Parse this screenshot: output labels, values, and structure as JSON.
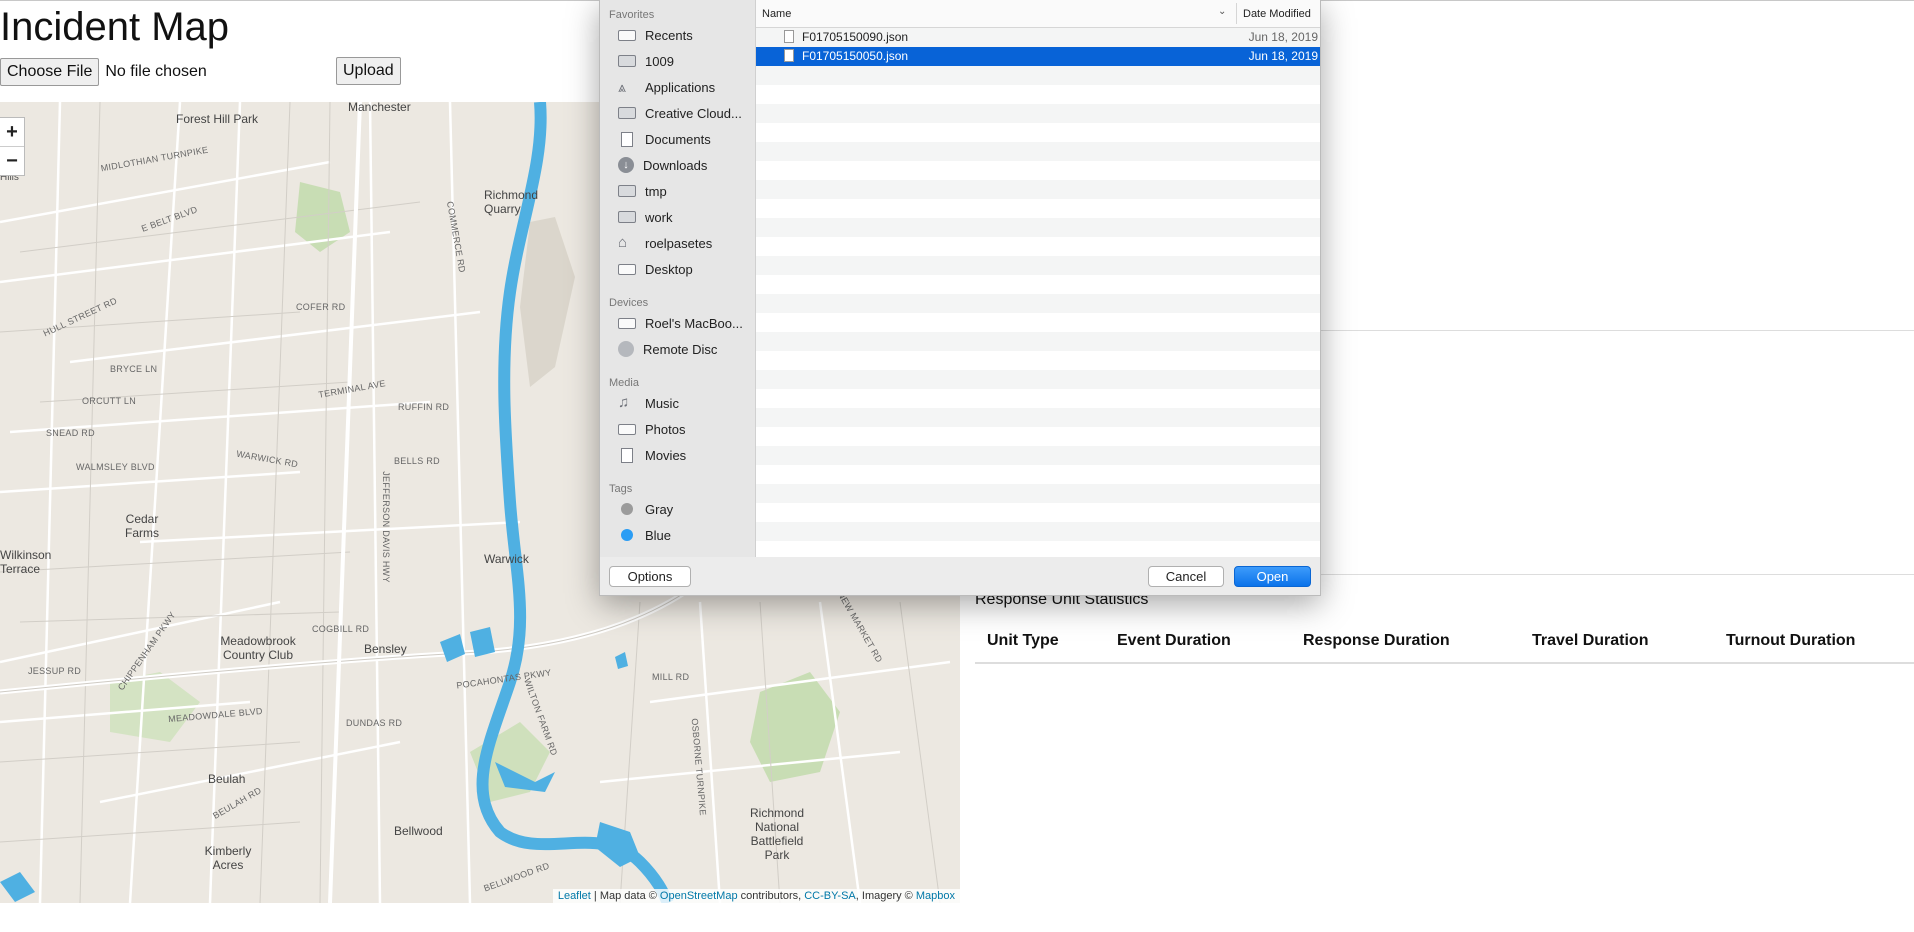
{
  "page": {
    "title": "Incident Map",
    "choose_file_label": "Choose File",
    "file_status": "No file chosen",
    "upload_label": "Upload"
  },
  "map": {
    "zoom_in": "+",
    "zoom_out": "−",
    "places": [
      "Forest Hill Park",
      "Manchester",
      "Richmond Quarry",
      "Cedar Farms",
      "Meadowbrook Country Club",
      "Bensley",
      "Warwick",
      "Beulah",
      "Kimberly Acres",
      "Bellwood",
      "Richmond National Battlefield Park",
      "Wilkinson Terrace",
      "Hills"
    ],
    "roads": [
      "MIDLOTHIAN TURNPIKE",
      "E BELT BLVD",
      "COFER RD",
      "HULL STREET RD",
      "BRYCE LN",
      "ORCUTT LN",
      "SNEAD RD",
      "WALMSLEY BLVD",
      "WARWICK RD",
      "TERMINAL AVE",
      "RUFFIN RD",
      "BELLS RD",
      "JEFFERSON DAVIS HWY",
      "COMMERCE RD",
      "POCAHONTAS PKWY",
      "CHIPPENHAM PKWY",
      "MEADOWDALE BLVD",
      "JESSUP RD",
      "COGBILL RD",
      "DUNDAS RD",
      "MILL RD",
      "OSBORNE TURNPIKE",
      "BELLWOOD RD",
      "NEW MARKET RD",
      "BEULAH RD",
      "WILTON FARM RD"
    ],
    "attribution": {
      "leaflet": "Leaflet",
      "text1": " | Map data © ",
      "osm": "OpenStreetMap",
      "text2": " contributors, ",
      "license": "CC-BY-SA",
      "text3": ", Imagery © ",
      "mapbox": "Mapbox"
    }
  },
  "stats": {
    "title": "Response Unit Statistics",
    "columns": [
      "Unit Type",
      "Event Duration",
      "Response Duration",
      "Travel Duration",
      "Turnout Duration"
    ]
  },
  "dialog": {
    "sections": {
      "favorites": "Favorites",
      "devices": "Devices",
      "media": "Media",
      "tags": "Tags"
    },
    "favorites": [
      "Recents",
      "1009",
      "Applications",
      "Creative Cloud...",
      "Documents",
      "Downloads",
      "tmp",
      "work",
      "roelpasetes",
      "Desktop"
    ],
    "devices": [
      "Roel's MacBoo...",
      "Remote Disc"
    ],
    "media": [
      "Music",
      "Photos",
      "Movies"
    ],
    "tags": [
      "Gray",
      "Blue"
    ],
    "tag_colors": {
      "gray": "#9b9b9b",
      "blue": "#2b9df4"
    },
    "columns": {
      "name": "Name",
      "date": "Date Modified"
    },
    "files": [
      {
        "name": "F01705150090.json",
        "date": "Jun 18, 2019"
      },
      {
        "name": "F01705150050.json",
        "date": "Jun 18, 2019"
      }
    ],
    "options_label": "Options",
    "cancel_label": "Cancel",
    "open_label": "Open"
  }
}
